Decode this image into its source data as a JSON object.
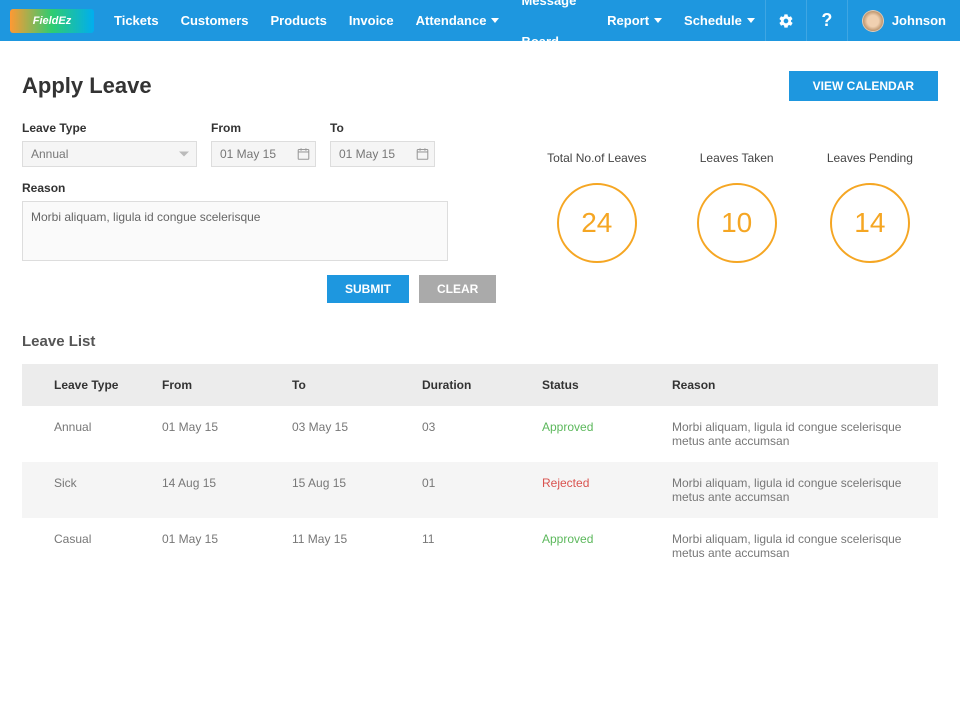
{
  "header": {
    "logo_text": "FieldEz",
    "nav": [
      "Tickets",
      "Customers",
      "Products",
      "Invoice",
      "Attendance",
      "Message Board",
      "Report",
      "Schedule"
    ],
    "nav_dropdown_indices": [
      4,
      6,
      7
    ],
    "user_name": "Johnson"
  },
  "page": {
    "title": "Apply Leave",
    "view_calendar": "VIEW CALENDAR"
  },
  "form": {
    "leave_type_label": "Leave Type",
    "leave_type_value": "Annual",
    "from_label": "From",
    "from_value": "01 May 15",
    "to_label": "To",
    "to_value": "01 May 15",
    "reason_label": "Reason",
    "reason_value": "Morbi aliquam, ligula id congue scelerisque",
    "submit": "SUBMIT",
    "clear": "CLEAR"
  },
  "stats": [
    {
      "label": "Total No.of Leaves",
      "value": "24"
    },
    {
      "label": "Leaves Taken",
      "value": "10"
    },
    {
      "label": "Leaves Pending",
      "value": "14"
    }
  ],
  "leave_list": {
    "title": "Leave List",
    "headers": [
      "Leave Type",
      "From",
      "To",
      "Duration",
      "Status",
      "Reason"
    ],
    "rows": [
      {
        "type": "Annual",
        "from": "01 May 15",
        "to": "03 May 15",
        "duration": "03",
        "status": "Approved",
        "status_class": "approved",
        "reason": "Morbi aliquam, ligula id congue scelerisque metus ante accumsan"
      },
      {
        "type": "Sick",
        "from": "14 Aug 15",
        "to": "15 Aug 15",
        "duration": "01",
        "status": "Rejected",
        "status_class": "rejected",
        "reason": "Morbi aliquam, ligula id congue scelerisque metus ante accumsan"
      },
      {
        "type": "Casual",
        "from": "01 May 15",
        "to": "11 May 15",
        "duration": "11",
        "status": "Approved",
        "status_class": "approved",
        "reason": "Morbi aliquam, ligula id congue scelerisque metus ante accumsan"
      }
    ]
  }
}
